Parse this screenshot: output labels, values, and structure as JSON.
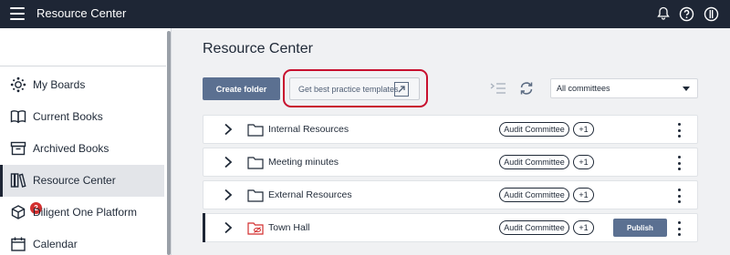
{
  "topbar": {
    "title": "Resource Center",
    "icons": [
      "menu-icon",
      "bell-icon",
      "help-icon",
      "user-icon"
    ]
  },
  "sidebar": {
    "items": [
      {
        "label": "My Boards",
        "icon": "boards-icon",
        "active": false
      },
      {
        "label": "Current Books",
        "icon": "book-open-icon",
        "active": false
      },
      {
        "label": "Archived Books",
        "icon": "archive-icon",
        "active": false
      },
      {
        "label": "Resource Center",
        "icon": "library-icon",
        "active": true
      },
      {
        "label": "Diligent One Platform",
        "icon": "cube-icon",
        "active": false,
        "badge": "2"
      },
      {
        "label": "Calendar",
        "icon": "calendar-icon",
        "active": false
      }
    ]
  },
  "main": {
    "title": "Resource Center",
    "create_folder_label": "Create folder",
    "templates_label": "Get best practice templates",
    "filter": {
      "selected": "All committees"
    },
    "rows": [
      {
        "name": "Internal Resources",
        "committee": "Audit Committee",
        "extra": "+1",
        "publish": null,
        "restricted": false
      },
      {
        "name": "Meeting minutes",
        "committee": "Audit Committee",
        "extra": "+1",
        "publish": null,
        "restricted": false
      },
      {
        "name": "External Resources",
        "committee": "Audit Committee",
        "extra": "+1",
        "publish": null,
        "restricted": false
      },
      {
        "name": "Town Hall",
        "committee": "Audit Committee",
        "extra": "+1",
        "publish": "Publish",
        "restricted": true
      }
    ]
  },
  "colors": {
    "topbar": "#1e2635",
    "accent_button": "#5b7091",
    "highlight": "#c8102e",
    "badge": "#d32f2f"
  }
}
